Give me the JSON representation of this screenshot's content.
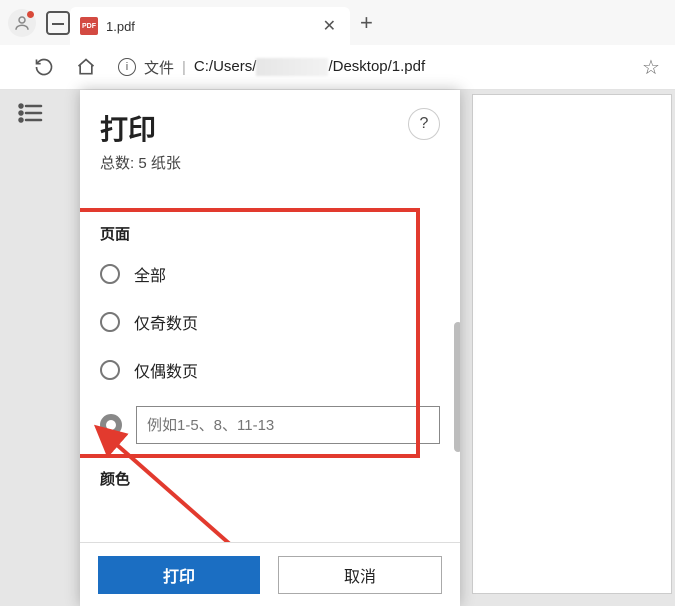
{
  "tab": {
    "label": "1.pdf"
  },
  "addressbar": {
    "file_label": "文件",
    "path_prefix": "C:/Users/",
    "path_suffix": "/Desktop/1.pdf"
  },
  "dialog": {
    "title": "打印",
    "summary": "总数: 5 纸张",
    "help": "?",
    "pages": {
      "label": "页面",
      "options": {
        "all": "全部",
        "odd": "仅奇数页",
        "even": "仅偶数页"
      },
      "custom_placeholder": "例如1-5、8、11-13"
    },
    "color_label": "颜色",
    "buttons": {
      "print": "打印",
      "cancel": "取消"
    }
  }
}
